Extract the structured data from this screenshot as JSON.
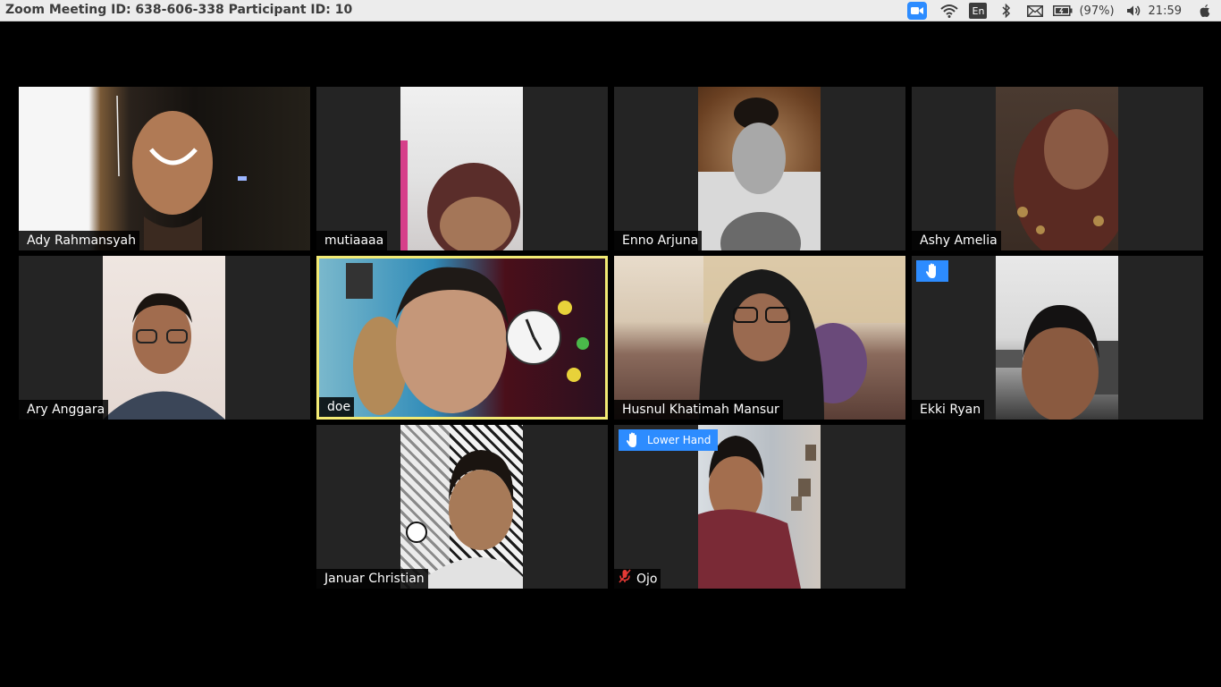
{
  "window": {
    "title": "Zoom Meeting ID: 638-606-338 Participant ID: 10"
  },
  "tray": {
    "keyboard_layout": "En",
    "battery_percent": "(97%)",
    "time": "21:59",
    "icons": [
      "zoom-icon",
      "wifi-icon",
      "keyboard-layout-indicator",
      "bluetooth-icon",
      "mail-icon",
      "battery-icon",
      "volume-icon",
      "power-icon"
    ]
  },
  "colors": {
    "accent": "#2d8cff",
    "active_speaker_border": "#f2ea74",
    "tile_bg": "#242424",
    "muted_icon": "#e53935"
  },
  "participants": [
    {
      "name": "Ady Rahmansyah"
    },
    {
      "name": "mutiaaaa"
    },
    {
      "name": "Enno Arjuna"
    },
    {
      "name": "Ashy Amelia"
    },
    {
      "name": "Ary Anggara"
    },
    {
      "name": "doe",
      "active_speaker": true
    },
    {
      "name": "Husnul Khatimah Mansur"
    },
    {
      "name": "Ekki Ryan",
      "hand_raised": true
    },
    {
      "name": "Januar Christian"
    },
    {
      "name": "Ojo",
      "muted": true,
      "hand_raised": true,
      "lower_hand_label": "Lower Hand"
    }
  ]
}
